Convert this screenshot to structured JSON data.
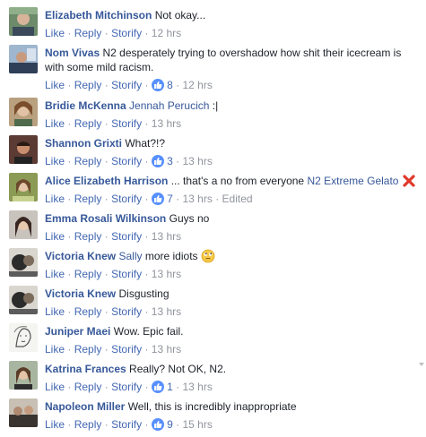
{
  "actions": {
    "like": "Like",
    "reply": "Reply",
    "storify": "Storify",
    "separator": "·",
    "edited": "Edited"
  },
  "comments": [
    {
      "author": "Elizabeth Mitchinson",
      "mention": "",
      "text": "Not okay...",
      "likes": "",
      "time": "12 hrs"
    },
    {
      "author": "Nom Vivas",
      "mention": "",
      "text": "N2 desperately trying to overshadow how shit their icecream is with some mild racism.",
      "likes": "8",
      "time": "12 hrs"
    },
    {
      "author": "Bridie McKenna",
      "mention": "Jennah Perucich",
      "text": ":|",
      "likes": "",
      "time": "13 hrs"
    },
    {
      "author": "Shannon Grixti",
      "mention": "",
      "text": "What?!?",
      "likes": "3",
      "time": "13 hrs"
    },
    {
      "author": "Alice Elizabeth Harrison",
      "mention": "N2 Extreme Gelato",
      "text": "... that's a no from everyone",
      "likes": "7",
      "time": "13 hrs"
    },
    {
      "author": "Emma Rosali Wilkinson",
      "mention": "",
      "text": "Guys no",
      "likes": "",
      "time": "13 hrs"
    },
    {
      "author": "Victoria Knew",
      "mention": "Sally",
      "text": "more idiots",
      "likes": "",
      "time": "13 hrs"
    },
    {
      "author": "Victoria Knew",
      "mention": "",
      "text": "Disgusting",
      "likes": "",
      "time": "13 hrs"
    },
    {
      "author": "Juniper Maei",
      "mention": "",
      "text": "Wow. Epic fail.",
      "likes": "",
      "time": "13 hrs"
    },
    {
      "author": "Katrina Frances",
      "mention": "",
      "text": "Really? Not OK, N2.",
      "likes": "1",
      "time": "13 hrs"
    },
    {
      "author": "Napoleon Miller",
      "mention": "",
      "text": "Well, this is incredibly inappropriate",
      "likes": "9",
      "time": "15 hrs"
    }
  ]
}
